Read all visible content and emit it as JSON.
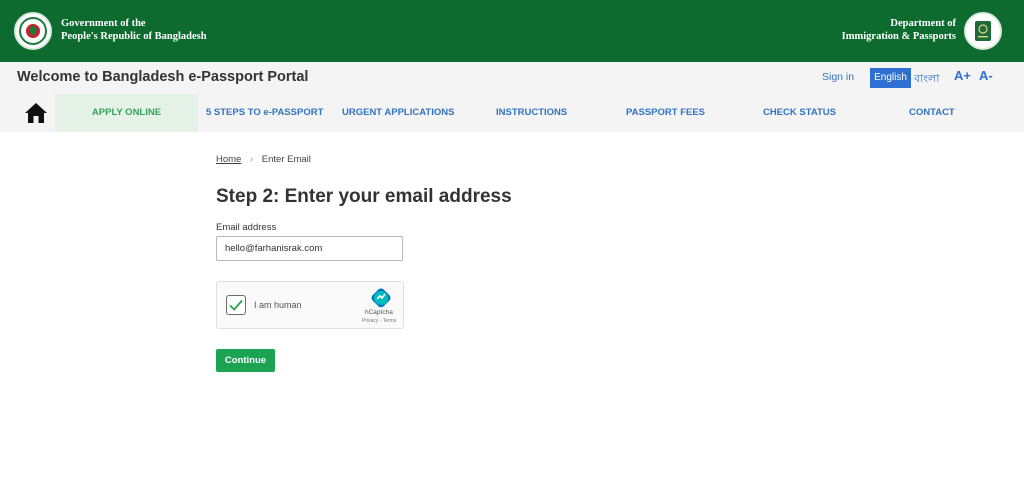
{
  "header": {
    "gov_line1": "Government of the",
    "gov_line2": "People's Republic of Bangladesh",
    "dept_line1": "Department of",
    "dept_line2": "Immigration & Passports",
    "brand_green": "#0e6b2f"
  },
  "topbar": {
    "portal_title": "Welcome to Bangladesh e-Passport Portal",
    "signin_label": "Sign in",
    "lang_english": "English",
    "lang_bangla": "বাংলা",
    "font_increase": "A+",
    "font_decrease": "A-"
  },
  "nav": {
    "home_icon": "home-icon",
    "items": [
      {
        "label": "APPLY ONLINE",
        "active": true
      },
      {
        "label": "5 STEPS TO e-PASSPORT"
      },
      {
        "label": "URGENT APPLICATIONS"
      },
      {
        "label": "INSTRUCTIONS"
      },
      {
        "label": "PASSPORT FEES"
      },
      {
        "label": "CHECK STATUS"
      },
      {
        "label": "CONTACT"
      }
    ]
  },
  "breadcrumb": {
    "home": "Home",
    "current": "Enter Email"
  },
  "form": {
    "title": "Step 2: Enter your email address",
    "email_label": "Email address",
    "email_value": "hello@farhanisrak.com",
    "captcha_label": "I am human",
    "captcha_checked": true,
    "captcha_brand": "hCaptcha",
    "captcha_links": "Privacy - Terms",
    "continue_label": "Continue"
  }
}
